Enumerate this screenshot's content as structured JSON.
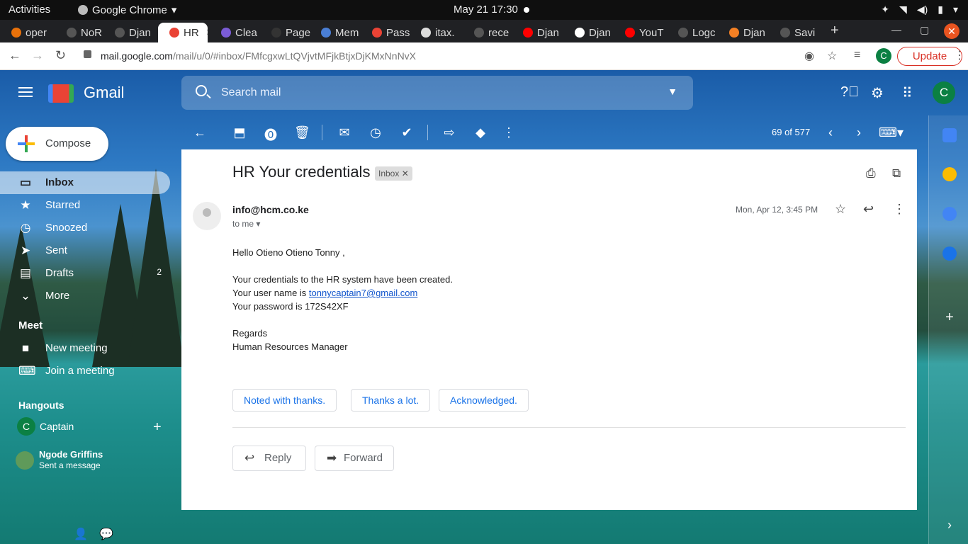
{
  "system": {
    "activities": "Activities",
    "app_name": "Google Chrome",
    "clock": "May 21  17:30"
  },
  "tabs": [
    {
      "label": "oper",
      "color": "#e8710a"
    },
    {
      "label": "NoR",
      "color": "#555555"
    },
    {
      "label": "Djan",
      "color": "#555555"
    },
    {
      "label": "HR",
      "color": "#ea4335",
      "active": true
    },
    {
      "label": "Clea",
      "color": "#7b5cd6"
    },
    {
      "label": "Page",
      "color": "#333333"
    },
    {
      "label": "Mem",
      "color": "#4a7fd6"
    },
    {
      "label": "Pass",
      "color": "#ea4335"
    },
    {
      "label": "itax.",
      "color": "#dddddd"
    },
    {
      "label": "rece",
      "color": "#555555"
    },
    {
      "label": "Djan",
      "color": "#ff0000"
    },
    {
      "label": "Djan",
      "color": "#ffffff"
    },
    {
      "label": "YouT",
      "color": "#ff0000"
    },
    {
      "label": "Logc",
      "color": "#555555"
    },
    {
      "label": "Djan",
      "color": "#f48024"
    },
    {
      "label": "Savi",
      "color": "#555555"
    }
  ],
  "browser": {
    "url_host": "mail.google.com",
    "url_path": "/mail/u/0/#inbox/FMfcgxwLtQVjvtMFjkBtjxDjKMxNnNvX",
    "profile_initial": "C",
    "update_label": "Update"
  },
  "gmail": {
    "logo_text": "Gmail",
    "search_placeholder": "Search mail",
    "avatar_initial": "C",
    "compose_label": "Compose",
    "nav": [
      {
        "label": "Inbox",
        "icon": "inbox-icon",
        "active": true
      },
      {
        "label": "Starred",
        "icon": "star-icon"
      },
      {
        "label": "Snoozed",
        "icon": "clock-icon"
      },
      {
        "label": "Sent",
        "icon": "send-icon"
      },
      {
        "label": "Drafts",
        "icon": "draft-icon",
        "count": "2"
      },
      {
        "label": "More",
        "icon": "chevron-down-icon"
      }
    ],
    "meet_header": "Meet",
    "meet_items": [
      {
        "label": "New meeting",
        "icon": "video-icon"
      },
      {
        "label": "Join a meeting",
        "icon": "keyboard-icon"
      }
    ],
    "hangouts_header": "Hangouts",
    "hangouts_user": {
      "initial": "C",
      "name": "Captain"
    },
    "hangouts_contact": {
      "name": "Ngode Griffins",
      "status": "Sent a message"
    },
    "counter": "69 of 577"
  },
  "message": {
    "subject": "HR Your credentials",
    "label_chip": "Inbox",
    "sender": "info@hcm.co.ke",
    "to": "to me",
    "date": "Mon, Apr 12, 3:45 PM",
    "greeting": "Hello Otieno Otieno Tonny ,",
    "line1": "Your credentials to the HR system have been created.",
    "line2_prefix": "Your user name is ",
    "line2_link": "tonnycaptain7@gmail.com",
    "line3": "Your password is 172S42XF",
    "regards": "Regards",
    "signature": "Human Resources Manager",
    "smart_replies": [
      "Noted with thanks.",
      "Thanks a lot.",
      "Acknowledged."
    ],
    "reply_label": "Reply",
    "forward_label": "Forward"
  }
}
